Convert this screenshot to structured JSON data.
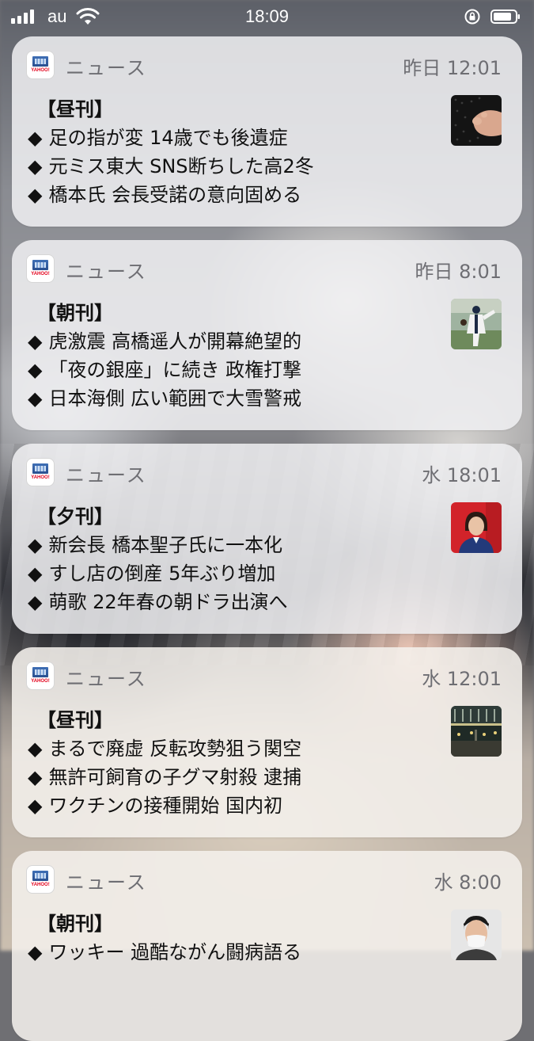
{
  "status_bar": {
    "carrier": "au",
    "time": "18:09"
  },
  "notifications": [
    {
      "app": "ニュース",
      "time": "昨日 12:01",
      "edition": "【昼刊】",
      "bullet": "◆",
      "headlines": [
        "足の指が変 14歳でも後遺症",
        "元ミス東大 SNS断ちした高2冬",
        "橋本氏 会長受諾の意向固める"
      ],
      "thumbnail": "foot-photo"
    },
    {
      "app": "ニュース",
      "time": "昨日 8:01",
      "edition": "【朝刊】",
      "bullet": "◆",
      "headlines": [
        "虎激震 高橋遥人が開幕絶望的",
        "「夜の銀座」に続き 政権打撃",
        "日本海側 広い範囲で大雪警戒"
      ],
      "thumbnail": "baseball-pitcher-photo"
    },
    {
      "app": "ニュース",
      "time": "水 18:01",
      "edition": "【夕刊】",
      "bullet": "◆",
      "headlines": [
        "新会長 橋本聖子氏に一本化",
        "すし店の倒産 5年ぶり増加",
        "萌歌 22年春の朝ドラ出演へ"
      ],
      "thumbnail": "woman-portrait-photo"
    },
    {
      "app": "ニュース",
      "time": "水 12:01",
      "edition": "【昼刊】",
      "bullet": "◆",
      "headlines": [
        "まるで廃虚 反転攻勢狙う関空",
        "無許可飼育の子グマ射殺 逮捕",
        "ワクチンの接種開始 国内初"
      ],
      "thumbnail": "empty-airport-photo"
    },
    {
      "app": "ニュース",
      "time": "水 8:00",
      "edition": "【朝刊】",
      "bullet": "◆",
      "headlines": [
        "ワッキー 過酷ながん闘病語る"
      ],
      "thumbnail": "man-with-mask-photo"
    }
  ],
  "icons": {
    "app_icon": "yahoo-news-app-icon",
    "signal": "cellular-signal-icon",
    "wifi": "wifi-icon",
    "rotation_lock": "rotation-lock-icon",
    "battery": "battery-icon"
  }
}
